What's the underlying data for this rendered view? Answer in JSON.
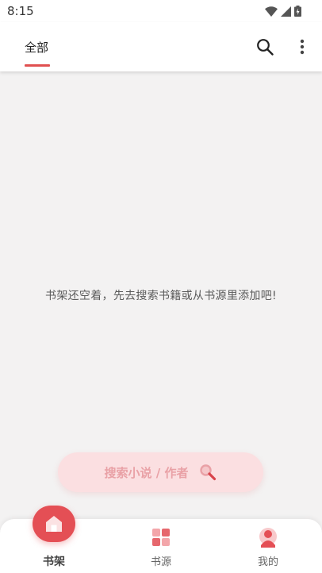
{
  "status_bar": {
    "time": "8:15"
  },
  "app_bar": {
    "tabs": [
      {
        "label": "全部",
        "selected": true
      }
    ],
    "actions": [
      "search-icon",
      "more-vert-icon"
    ],
    "accent_color": "#e05050"
  },
  "main": {
    "empty_message": "书架还空着，先去搜索书籍或从书源里添加吧!"
  },
  "search_button": {
    "label": "搜索小说 / 作者",
    "icon": "magnifier-icon",
    "background": "#fbdfe1"
  },
  "bottom_nav": {
    "items": [
      {
        "label": "书架",
        "icon": "home-icon",
        "active": true
      },
      {
        "label": "书源",
        "icon": "grid-icon",
        "active": false
      },
      {
        "label": "我的",
        "icon": "person-icon",
        "active": false
      }
    ],
    "active_color": "#e44f55"
  }
}
